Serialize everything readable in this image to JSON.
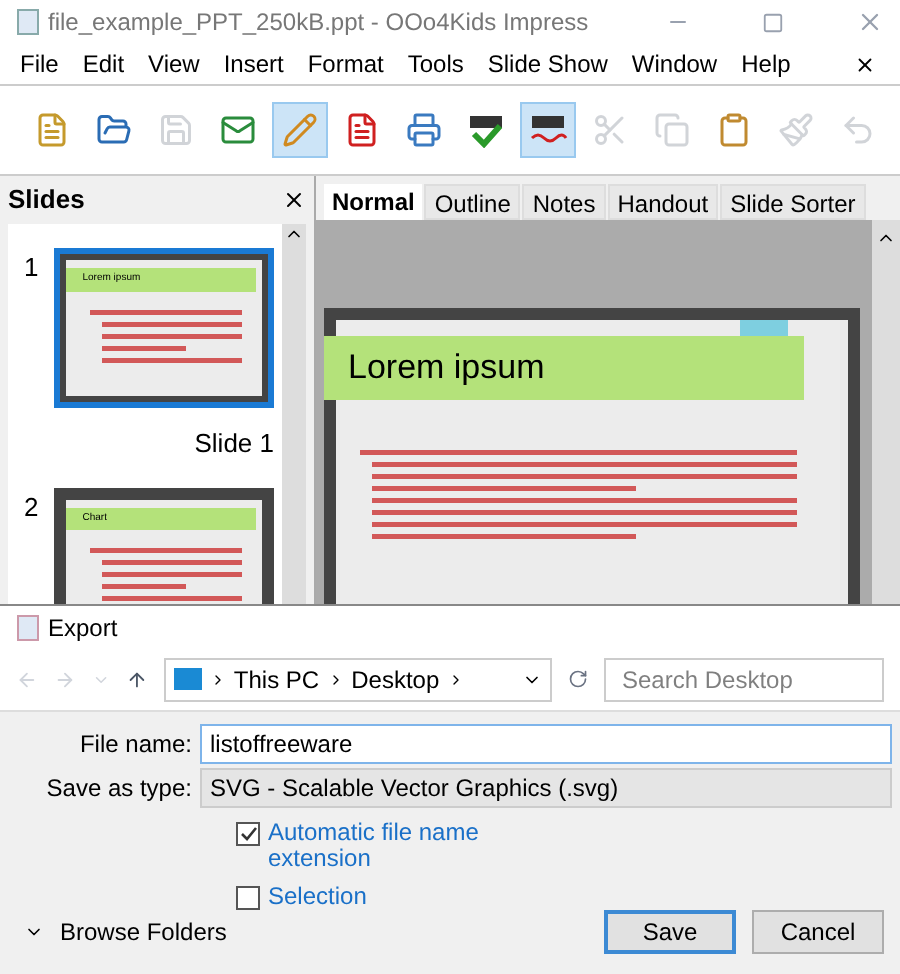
{
  "window": {
    "title": "file_example_PPT_250kB.ppt - OOo4Kids Impress"
  },
  "menu": [
    "File",
    "Edit",
    "View",
    "Insert",
    "Format",
    "Tools",
    "Slide Show",
    "Window",
    "Help"
  ],
  "toolbar": [
    {
      "kind": "template",
      "selected": false,
      "disabled": false
    },
    {
      "kind": "open",
      "selected": false,
      "disabled": false
    },
    {
      "kind": "save",
      "selected": false,
      "disabled": true
    },
    {
      "kind": "mail",
      "selected": false,
      "disabled": false
    },
    {
      "kind": "edit",
      "selected": true,
      "disabled": false
    },
    {
      "kind": "pdf",
      "selected": false,
      "disabled": false
    },
    {
      "kind": "print",
      "selected": false,
      "disabled": false
    },
    {
      "kind": "spell",
      "selected": false,
      "disabled": false
    },
    {
      "kind": "autospell",
      "selected": true,
      "disabled": false
    },
    {
      "kind": "cut",
      "selected": false,
      "disabled": true
    },
    {
      "kind": "copy",
      "selected": false,
      "disabled": true
    },
    {
      "kind": "paste",
      "selected": false,
      "disabled": false
    },
    {
      "kind": "brush",
      "selected": false,
      "disabled": true
    },
    {
      "kind": "undo",
      "selected": false,
      "disabled": true
    }
  ],
  "slides_panel": {
    "title": "Slides",
    "slides": [
      {
        "number": "1",
        "title": "Lorem ipsum",
        "label": "Slide 1",
        "selected": true
      },
      {
        "number": "2",
        "title": "Chart",
        "selected": false
      }
    ]
  },
  "tabs": [
    {
      "label": "Normal",
      "selected": true
    },
    {
      "label": "Outline",
      "selected": false
    },
    {
      "label": "Notes",
      "selected": false
    },
    {
      "label": "Handout",
      "selected": false
    },
    {
      "label": "Slide Sorter",
      "selected": false
    }
  ],
  "slide": {
    "title": "Lorem ipsum"
  },
  "dialog": {
    "title": "Export",
    "path": [
      "This PC",
      "Desktop"
    ],
    "search": {
      "placeholder": "Search Desktop"
    },
    "file_name": {
      "label": "File name:",
      "value": "listoffreeware"
    },
    "save_type": {
      "label": "Save as type:",
      "value": "SVG - Scalable Vector Graphics (.svg)"
    },
    "options": [
      {
        "label": "Automatic file name extension",
        "checked": true
      },
      {
        "label": "Selection",
        "checked": false
      }
    ],
    "browse": "Browse Folders",
    "buttons": [
      {
        "label": "Save",
        "selected": true
      },
      {
        "label": "Cancel",
        "selected": false
      }
    ]
  }
}
